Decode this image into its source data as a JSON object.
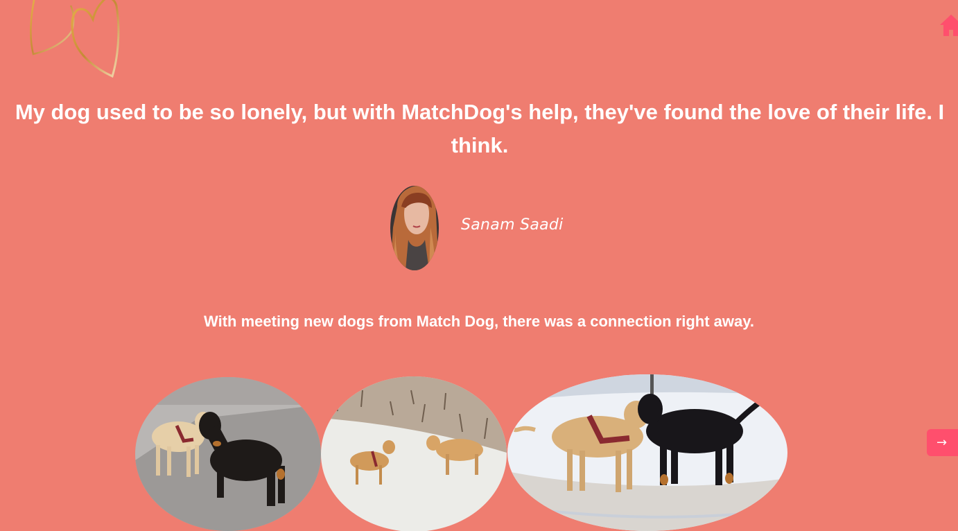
{
  "header": {
    "logo_icon": "double-heart-logo-icon",
    "home_icon": "home-icon",
    "home_color": "#ff4f6d"
  },
  "testimonial": {
    "quote": "My dog used to be so lonely, but with MatchDog's help, they've found the love of their life. I think.",
    "author_name": "Sanam Saadi",
    "avatar_icon": "author-avatar"
  },
  "section": {
    "subheading": "With meeting new dogs from Match Dog, there was a connection right away."
  },
  "gallery": {
    "photos": [
      {
        "description_icon": "dogs-meeting-on-road-photo"
      },
      {
        "description_icon": "dogs-in-snowy-field-photo"
      },
      {
        "description_icon": "dogs-in-snow-nuzzling-photo"
      }
    ],
    "next_icon": "arrow-right-icon",
    "next_glyph": "→"
  },
  "colors": {
    "background": "#ef7d70",
    "accent": "#ff4f6d",
    "text": "#ffffff"
  }
}
